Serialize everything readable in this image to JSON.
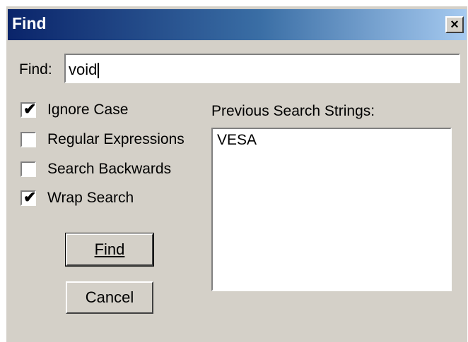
{
  "window": {
    "title": "Find",
    "close_glyph": "×"
  },
  "find": {
    "label": "Find:",
    "value": "void"
  },
  "options": [
    {
      "label": "Ignore Case",
      "checked": true
    },
    {
      "label": "Regular Expressions",
      "checked": false
    },
    {
      "label": "Search Backwards",
      "checked": false
    },
    {
      "label": "Wrap Search",
      "checked": true
    }
  ],
  "buttons": {
    "find_label": "Find",
    "cancel_label": "Cancel"
  },
  "previous": {
    "label": "Previous Search Strings:",
    "items": [
      "VESA"
    ]
  }
}
